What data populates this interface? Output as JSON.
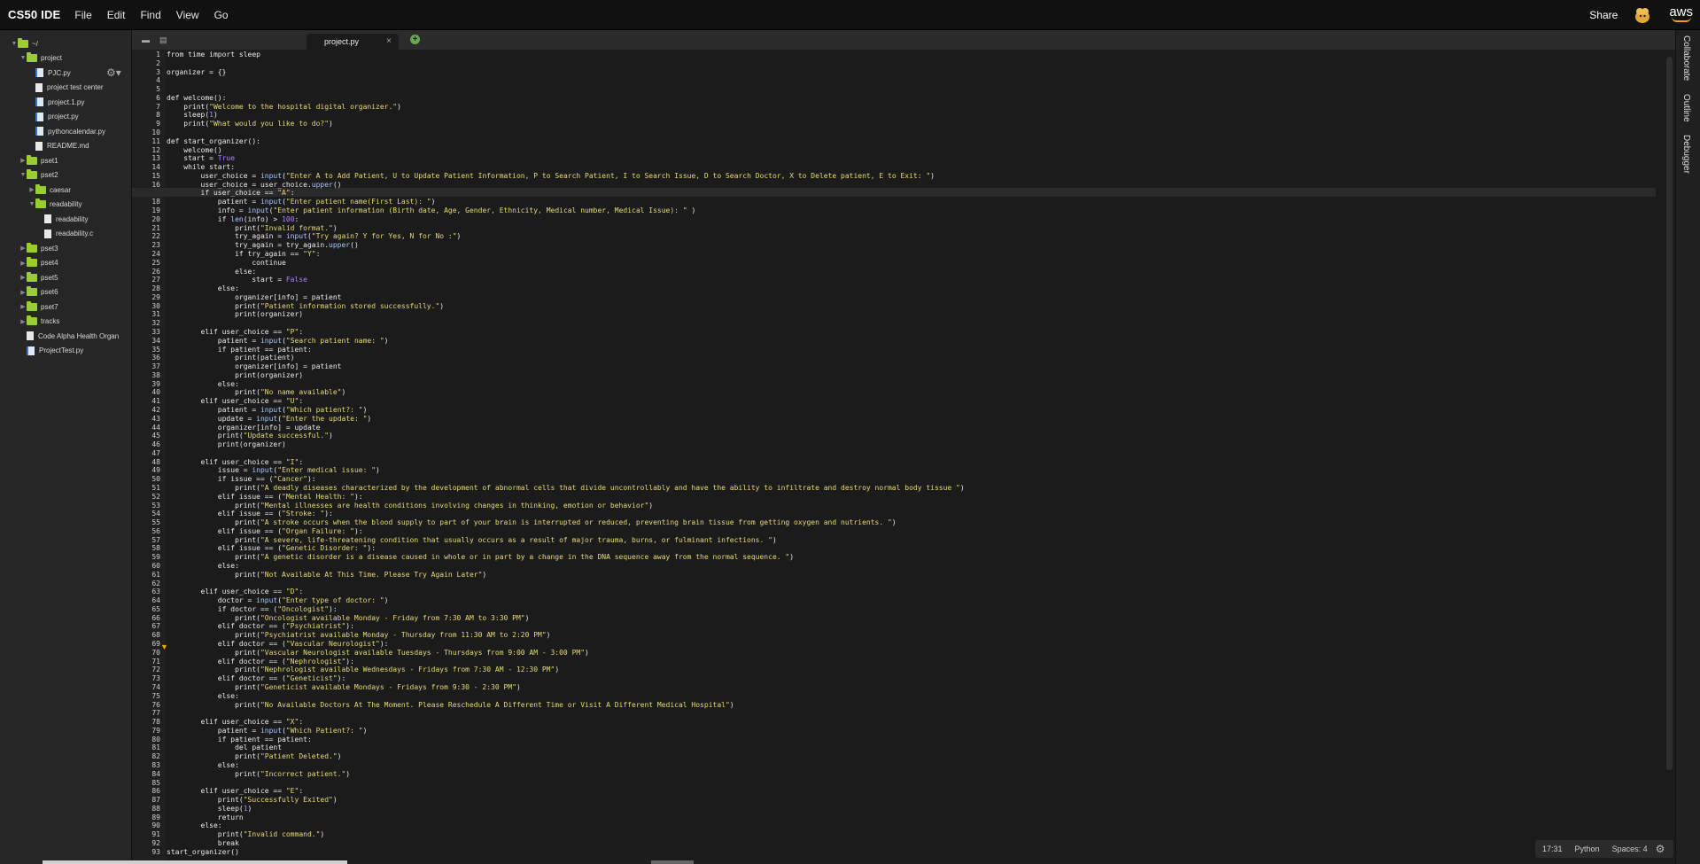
{
  "app": {
    "title": "CS50 IDE"
  },
  "menu": [
    "File",
    "Edit",
    "Find",
    "View",
    "Go"
  ],
  "header_right": {
    "share": "Share",
    "aws": "aws"
  },
  "file_tree": [
    {
      "label": "~/",
      "type": "folder",
      "depth": 0,
      "arrow": "▼"
    },
    {
      "label": "project",
      "type": "folder",
      "depth": 1,
      "arrow": "▼"
    },
    {
      "label": "PJC.py",
      "type": "py",
      "depth": 2,
      "arrow": ""
    },
    {
      "label": "project test center",
      "type": "file",
      "depth": 2,
      "arrow": ""
    },
    {
      "label": "project.1.py",
      "type": "py",
      "depth": 2,
      "arrow": ""
    },
    {
      "label": "project.py",
      "type": "py",
      "depth": 2,
      "arrow": ""
    },
    {
      "label": "pythoncalendar.py",
      "type": "py",
      "depth": 2,
      "arrow": ""
    },
    {
      "label": "README.md",
      "type": "file",
      "depth": 2,
      "arrow": ""
    },
    {
      "label": "pset1",
      "type": "folder",
      "depth": 1,
      "arrow": "▶"
    },
    {
      "label": "pset2",
      "type": "folder",
      "depth": 1,
      "arrow": "▼"
    },
    {
      "label": "caesar",
      "type": "folder",
      "depth": 2,
      "arrow": "▶"
    },
    {
      "label": "readability",
      "type": "folder",
      "depth": 2,
      "arrow": "▼"
    },
    {
      "label": "readability",
      "type": "file",
      "depth": 3,
      "arrow": ""
    },
    {
      "label": "readability.c",
      "type": "file",
      "depth": 3,
      "arrow": ""
    },
    {
      "label": "pset3",
      "type": "folder",
      "depth": 1,
      "arrow": "▶"
    },
    {
      "label": "pset4",
      "type": "folder",
      "depth": 1,
      "arrow": "▶"
    },
    {
      "label": "pset5",
      "type": "folder",
      "depth": 1,
      "arrow": "▶"
    },
    {
      "label": "pset6",
      "type": "folder",
      "depth": 1,
      "arrow": "▶"
    },
    {
      "label": "pset7",
      "type": "folder",
      "depth": 1,
      "arrow": "▶"
    },
    {
      "label": "tracks",
      "type": "folder",
      "depth": 1,
      "arrow": "▶"
    },
    {
      "label": "Code Alpha Health Organ",
      "type": "file",
      "depth": 1,
      "arrow": ""
    },
    {
      "label": "ProjectTest.py",
      "type": "py",
      "depth": 1,
      "arrow": ""
    }
  ],
  "editor": {
    "tab_label": "project.py",
    "close_glyph": "×",
    "active_line": 17,
    "warning_line": 63,
    "code": [
      "from time import sleep",
      "",
      "organizer = {}",
      "",
      "",
      "def welcome():",
      "    print(\"Welcome to the hospital digital organizer.\")",
      "    sleep(1)",
      "    print(\"What would you like to do?\")",
      "",
      "def start_organizer():",
      "    welcome()",
      "    start = True",
      "    while start:",
      "        user_choice = input(\"Enter A to Add Patient, U to Update Patient Information, P to Search Patient, I to Search Issue, D to Search Doctor, X to Delete patient, E to Exit: \")",
      "        user_choice = user_choice.upper()",
      "        if user_choice == \"A\":",
      "            patient = input(\"Enter patient name(First Last): \")",
      "            info = input(\"Enter patient information (Birth date, Age, Gender, Ethnicity, Medical number, Medical Issue): \" )",
      "            if len(info) > 100:",
      "                print(\"Invalid format.\")",
      "                try_again = input(\"Try again? Y for Yes, N for No :\")",
      "                try_again = try_again.upper()",
      "                if try_again == \"Y\":",
      "                    continue",
      "                else:",
      "                    start = False",
      "            else:",
      "                organizer[info] = patient",
      "                print(\"Patient information stored successfully.\")",
      "                print(organizer)",
      "",
      "        elif user_choice == \"P\":",
      "            patient = input(\"Search patient name: \")",
      "            if patient == patient:",
      "                print(patient)",
      "                organizer[info] = patient",
      "                print(organizer)",
      "            else:",
      "                print(\"No name available\")",
      "        elif user_choice == \"U\":",
      "            patient = input(\"Which patient?: \")",
      "            update = input(\"Enter the update: \")",
      "            organizer[info] = update",
      "            print(\"Update successful.\")",
      "            print(organizer)",
      "",
      "        elif user_choice == \"I\":",
      "            issue = input(\"Enter medical issue: \")",
      "            if issue == (\"Cancer\"):",
      "                print(\"A deadly diseases characterized by the development of abnormal cells that divide uncontrollably and have the ability to infiltrate and destroy normal body tissue \")",
      "            elif issue == (\"Mental Health: \"):",
      "                print(\"Mental illnesses are health conditions involving changes in thinking, emotion or behavior\")",
      "            elif issue == (\"Stroke: \"):",
      "                print(\"A stroke occurs when the blood supply to part of your brain is interrupted or reduced, preventing brain tissue from getting oxygen and nutrients. \")",
      "            elif issue == (\"Organ Failure: \"):",
      "                print(\"A severe, life-threatening condition that usually occurs as a result of major trauma, burns, or fulminant infections. \")",
      "            elif issue == (\"Genetic Disorder: \"):",
      "                print(\"A genetic disorder is a disease caused in whole or in part by a change in the DNA sequence away from the normal sequence. \")",
      "            else:",
      "                print(\"Not Available At This Time. Please Try Again Later\")",
      "",
      "        elif user_choice == \"D\":",
      "            doctor = input(\"Enter type of doctor: \")",
      "            if doctor == (\"Oncologist\"):",
      "                print(\"Oncologist available Monday - Friday from 7:30 AM to 3:30 PM\")",
      "            elif doctor == (\"Psychiatrist\"):",
      "                print(\"Psychiatrist available Monday - Thursday from 11:30 AM to 2:20 PM\")",
      "            elif doctor == (\"Vascular Neurologist\"):",
      "                print(\"Vascular Neurologist available Tuesdays - Thursdays from 9:00 AM - 3:00 PM\")",
      "            elif doctor == (\"Nephrologist\"):",
      "                print(\"Nephrologist available Wednesdays - Fridays from 7:30 AM - 12:30 PM\")",
      "            elif doctor == (\"Geneticist\"):",
      "                print(\"Geneticist available Mondays - Fridays from 9:30 - 2:30 PM\")",
      "            else:",
      "                print(\"No Available Doctors At The Moment. Please Reschedule A Different Time or Visit A Different Medical Hospital\")",
      "",
      "        elif user_choice == \"X\":",
      "            patient = input(\"Which Patient?: \")",
      "            if patient == patient:",
      "                del patient",
      "                print(\"Patient Deleted.\")",
      "            else:",
      "                print(\"Incorrect patient.\")",
      "",
      "        elif user_choice == \"E\":",
      "            print(\"Successfully Exited\")",
      "            sleep(1)",
      "            return",
      "        else:",
      "            print(\"Invalid command.\")",
      "            break",
      "start_organizer()"
    ]
  },
  "right_panel": [
    "Collaborate",
    "Outline",
    "Debugger"
  ],
  "status": {
    "cursor": "17:31",
    "language": "Python",
    "spaces": "Spaces: 4"
  },
  "colors": {
    "string": "#e6db74",
    "number": "#ae81ff",
    "folder": "#9acd32",
    "builtin": "#a9c9ff"
  }
}
